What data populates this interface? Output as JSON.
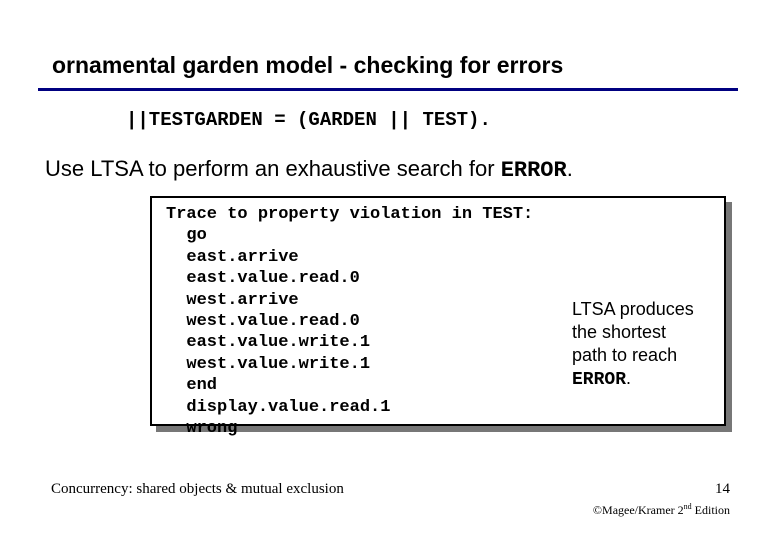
{
  "title": "ornamental garden model - checking for errors",
  "code_line": "||TESTGARDEN = (GARDEN || TEST).",
  "sentence_prefix": "Use LTSA to perform an exhaustive search for ",
  "sentence_error": "ERROR",
  "sentence_suffix": ".",
  "trace": "Trace to property violation in TEST:\n  go\n  east.arrive\n  east.value.read.0\n  west.arrive\n  west.value.read.0\n  east.value.write.1\n  west.value.write.1\n  end\n  display.value.read.1\n  wrong",
  "note_line1": "LTSA produces",
  "note_line2": "the shortest",
  "note_line3": "path to reach",
  "note_error": "ERROR",
  "note_suffix": ".",
  "footer_left": "Concurrency: shared objects & mutual exclusion",
  "footer_page": "14",
  "footer_credit_prefix": "©Magee/Kramer ",
  "footer_credit_edition_num": "2",
  "footer_credit_edition_sup": "nd",
  "footer_credit_edition_word": " Edition"
}
